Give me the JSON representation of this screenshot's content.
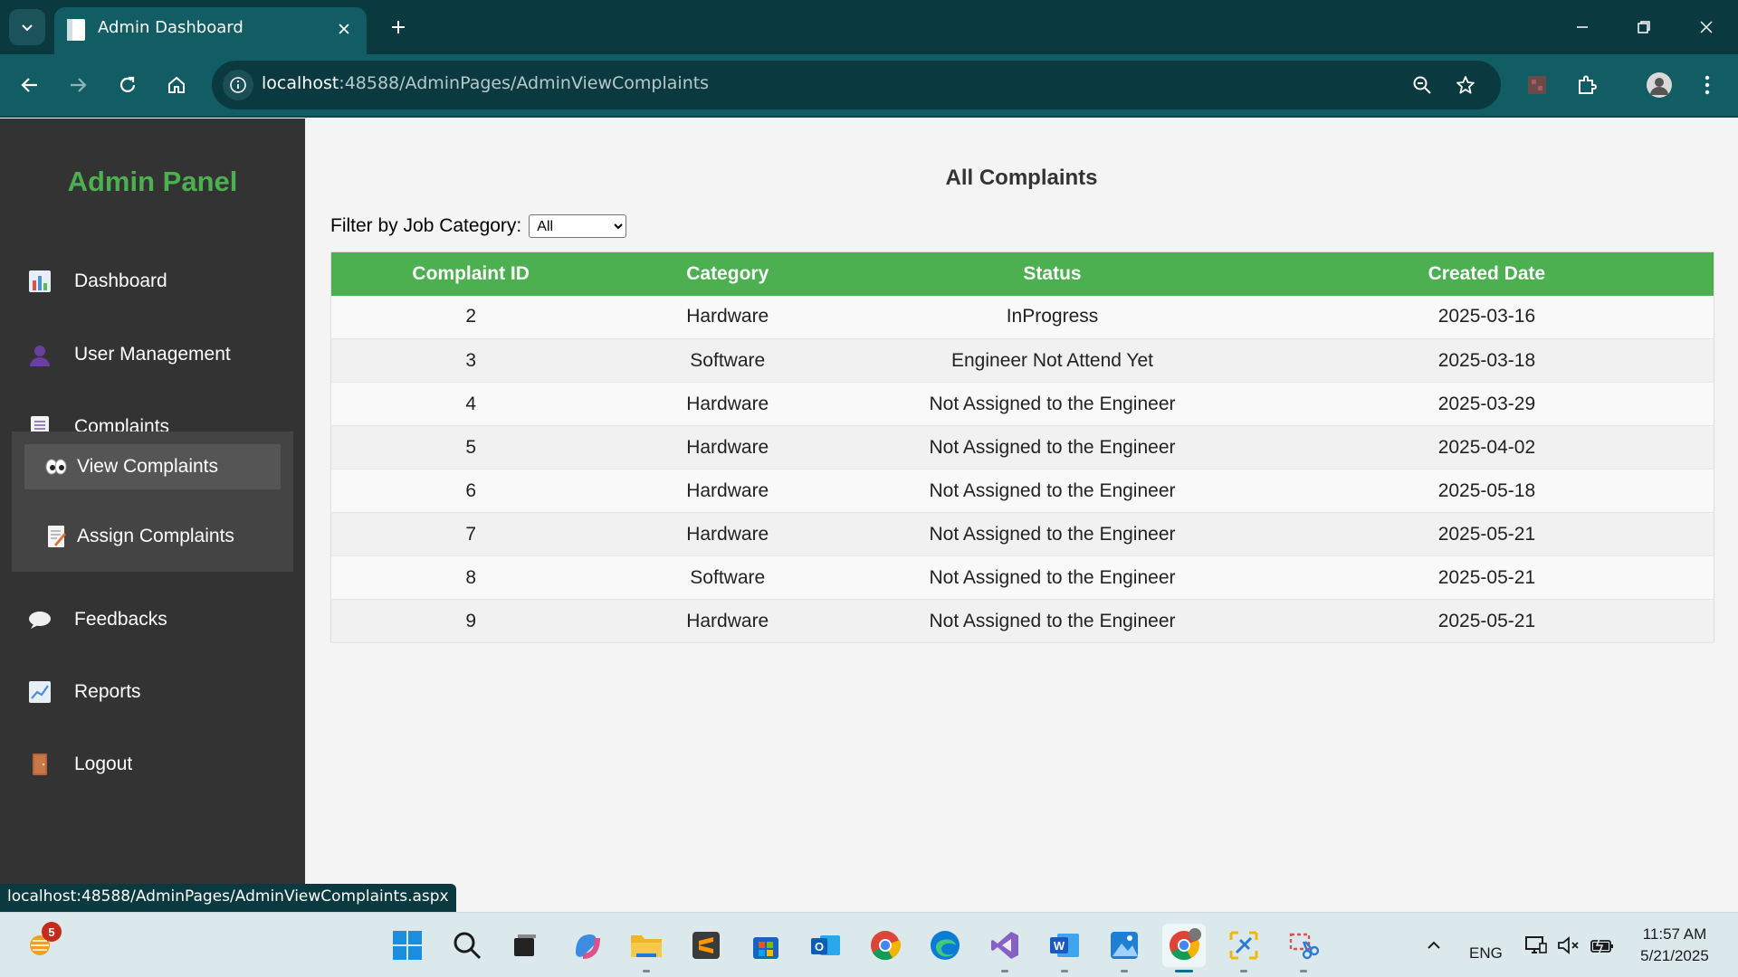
{
  "browser": {
    "tab_title": "Admin Dashboard",
    "url_host": "localhost",
    "url_path": ":48588/AdminPages/AdminViewComplaints",
    "hover_url": "localhost:48588/AdminPages/AdminViewComplaints.aspx"
  },
  "sidebar": {
    "brand": "Admin Panel",
    "items": [
      {
        "label": "Dashboard",
        "icon": "bar-chart-icon"
      },
      {
        "label": "User Management",
        "icon": "user-icon"
      },
      {
        "label": "Complaints",
        "icon": "document-icon"
      },
      {
        "label": "Feedbacks",
        "icon": "speech-bubble-icon"
      },
      {
        "label": "Reports",
        "icon": "line-chart-icon"
      },
      {
        "label": "Logout",
        "icon": "door-icon"
      }
    ],
    "submenu": [
      {
        "label": "View Complaints",
        "icon": "eyes-icon",
        "active": true
      },
      {
        "label": "Assign Complaints",
        "icon": "memo-icon",
        "active": false
      }
    ]
  },
  "main": {
    "title": "All Complaints",
    "filter_label": "Filter by Job Category:",
    "filter_value": "All",
    "table": {
      "headers": [
        "Complaint ID",
        "Category",
        "Status",
        "Created Date"
      ],
      "rows": [
        [
          "2",
          "Hardware",
          "InProgress",
          "2025-03-16"
        ],
        [
          "3",
          "Software",
          "Engineer Not Attend Yet",
          "2025-03-18"
        ],
        [
          "4",
          "Hardware",
          "Not Assigned to the Engineer",
          "2025-03-29"
        ],
        [
          "5",
          "Hardware",
          "Not Assigned to the Engineer",
          "2025-04-02"
        ],
        [
          "6",
          "Hardware",
          "Not Assigned to the Engineer",
          "2025-05-18"
        ],
        [
          "7",
          "Hardware",
          "Not Assigned to the Engineer",
          "2025-05-21"
        ],
        [
          "8",
          "Software",
          "Not Assigned to the Engineer",
          "2025-05-21"
        ],
        [
          "9",
          "Hardware",
          "Not Assigned to the Engineer",
          "2025-05-21"
        ]
      ]
    }
  },
  "taskbar": {
    "notification_count": "5",
    "language": "ENG",
    "time": "11:57 AM",
    "date": "5/21/2025"
  },
  "colors": {
    "accent_green": "#4caf50",
    "sidebar_bg": "#333333",
    "chrome_teal": "#125c63"
  }
}
